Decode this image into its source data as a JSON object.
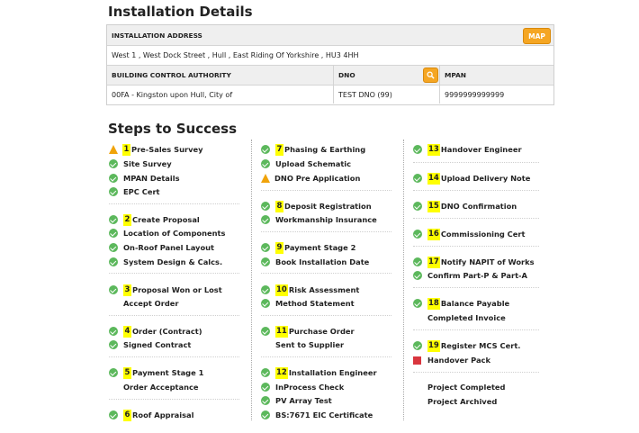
{
  "installation": {
    "title": "Installation Details",
    "address_label": "INSTALLATION ADDRESS",
    "map_button": "MAP",
    "address": "West 1 , West Dock Street , Hull , East Riding Of Yorkshire , HU3 4HH",
    "bca_label": "BUILDING CONTROL AUTHORITY",
    "dno_label": "DNO",
    "mpan_label": "MPAN",
    "bca_value": "00FA - Kingston upon Hull, City of",
    "dno_value": "TEST DNO (99)",
    "mpan_value": "9999999999999"
  },
  "steps": {
    "title": "Steps to Success",
    "col1": [
      {
        "icon": "warning-icon",
        "num": "1",
        "label": "Pre-Sales Survey"
      },
      {
        "icon": "check-icon",
        "label": "Site Survey"
      },
      {
        "icon": "check-icon",
        "label": "MPAN Details"
      },
      {
        "icon": "check-icon",
        "label": "EPC Cert"
      },
      {
        "icon": "check-icon",
        "num": "2",
        "label": "Create Proposal"
      },
      {
        "icon": "check-icon",
        "label": "Location of Components"
      },
      {
        "icon": "check-icon",
        "label": "On-Roof Panel Layout"
      },
      {
        "icon": "check-icon",
        "label": "System Design & Calcs."
      },
      {
        "icon": "check-icon",
        "num": "3",
        "label": "Proposal Won or Lost"
      },
      {
        "icon": "none",
        "label": "Accept Order"
      },
      {
        "icon": "check-icon",
        "num": "4",
        "label": "Order (Contract)"
      },
      {
        "icon": "check-icon",
        "label": "Signed Contract"
      },
      {
        "icon": "check-icon",
        "num": "5",
        "label": "Payment Stage 1"
      },
      {
        "icon": "none",
        "label": "Order Acceptance"
      },
      {
        "icon": "check-icon",
        "num": "6",
        "label": "Roof Appraisal"
      }
    ],
    "col2": [
      {
        "icon": "check-icon",
        "num": "7",
        "label": "Phasing & Earthing"
      },
      {
        "icon": "check-icon",
        "label": "Upload Schematic"
      },
      {
        "icon": "warning-icon",
        "label": "DNO Pre Application"
      },
      {
        "icon": "check-icon",
        "num": "8",
        "label": "Deposit Registration"
      },
      {
        "icon": "check-icon",
        "label": "Workmanship Insurance"
      },
      {
        "icon": "check-icon",
        "num": "9",
        "label": "Payment Stage 2"
      },
      {
        "icon": "check-icon",
        "label": "Book Installation Date"
      },
      {
        "icon": "check-icon",
        "num": "10",
        "label": "Risk Assessment"
      },
      {
        "icon": "check-icon",
        "label": "Method Statement"
      },
      {
        "icon": "check-icon",
        "num": "11",
        "label": "Purchase Order"
      },
      {
        "icon": "none",
        "label": "Sent to Supplier"
      },
      {
        "icon": "check-icon",
        "num": "12",
        "label": "Installation Engineer"
      },
      {
        "icon": "check-icon",
        "label": "InProcess Check"
      },
      {
        "icon": "check-icon",
        "label": "PV Array Test"
      },
      {
        "icon": "check-icon",
        "label": "BS:7671 EIC Certificate"
      }
    ],
    "col3": [
      {
        "icon": "check-icon",
        "num": "13",
        "label": "Handover Engineer"
      },
      {
        "icon": "check-icon",
        "num": "14",
        "label": "Upload Delivery Note"
      },
      {
        "icon": "check-icon",
        "num": "15",
        "label": "DNO Confirmation"
      },
      {
        "icon": "check-icon",
        "num": "16",
        "label": "Commissioning Cert"
      },
      {
        "icon": "check-icon",
        "num": "17",
        "label": "Notify NAPIT of Works"
      },
      {
        "icon": "check-icon",
        "label": "Confirm Part-P & Part-A"
      },
      {
        "icon": "check-icon",
        "num": "18",
        "label": "Balance Payable"
      },
      {
        "icon": "none",
        "label": "Completed Invoice"
      },
      {
        "icon": "check-icon",
        "num": "19",
        "label": "Register MCS Cert."
      },
      {
        "icon": "flag-icon",
        "label": "Handover Pack"
      },
      {
        "icon": "none",
        "label": "Project Completed"
      },
      {
        "icon": "none",
        "label": "Project Archived"
      }
    ]
  }
}
